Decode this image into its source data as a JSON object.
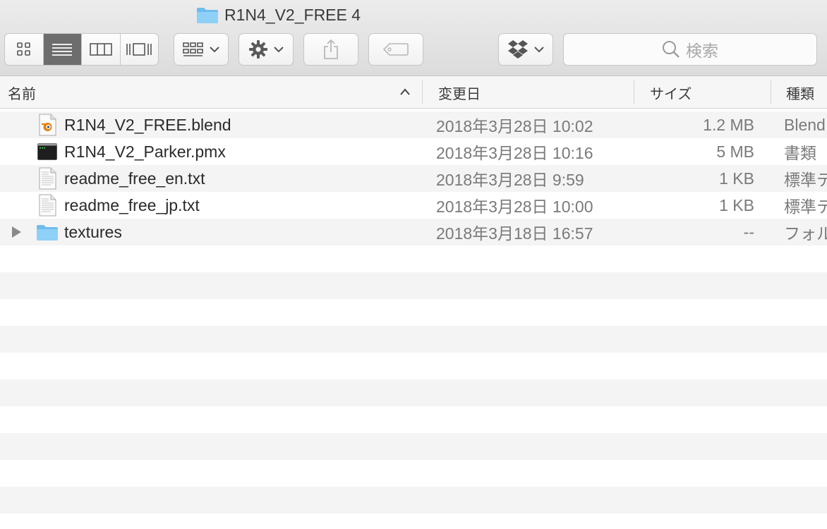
{
  "window": {
    "title": "R1N4_V2_FREE 4"
  },
  "toolbar": {
    "view_modes": [
      "icon-view",
      "list-view",
      "column-view",
      "cover-flow-view"
    ],
    "active_view": "list-view",
    "search_placeholder": "検索"
  },
  "columns": {
    "name": "名前",
    "date": "変更日",
    "size": "サイズ",
    "kind": "種類"
  },
  "files": [
    {
      "name": "R1N4_V2_FREE.blend",
      "date": "2018年3月28日 10:02",
      "size": "1.2 MB",
      "kind": "Blend",
      "icon": "blender-file-icon"
    },
    {
      "name": "R1N4_V2_Parker.pmx",
      "date": "2018年3月28日 10:16",
      "size": "5 MB",
      "kind": "書類",
      "icon": "executable-file-icon"
    },
    {
      "name": "readme_free_en.txt",
      "date": "2018年3月28日 9:59",
      "size": "1 KB",
      "kind": "標準テ",
      "icon": "text-file-icon"
    },
    {
      "name": "readme_free_jp.txt",
      "date": "2018年3月28日 10:00",
      "size": "1 KB",
      "kind": "標準テ",
      "icon": "text-file-icon"
    },
    {
      "name": "textures",
      "date": "2018年3月18日 16:57",
      "size": "--",
      "kind": "フォル",
      "icon": "folder-icon"
    }
  ],
  "colors": {
    "folder": "#7cc3f1",
    "active_segment": "#6d6d6d",
    "row_stripe": "#f4f4f4"
  }
}
